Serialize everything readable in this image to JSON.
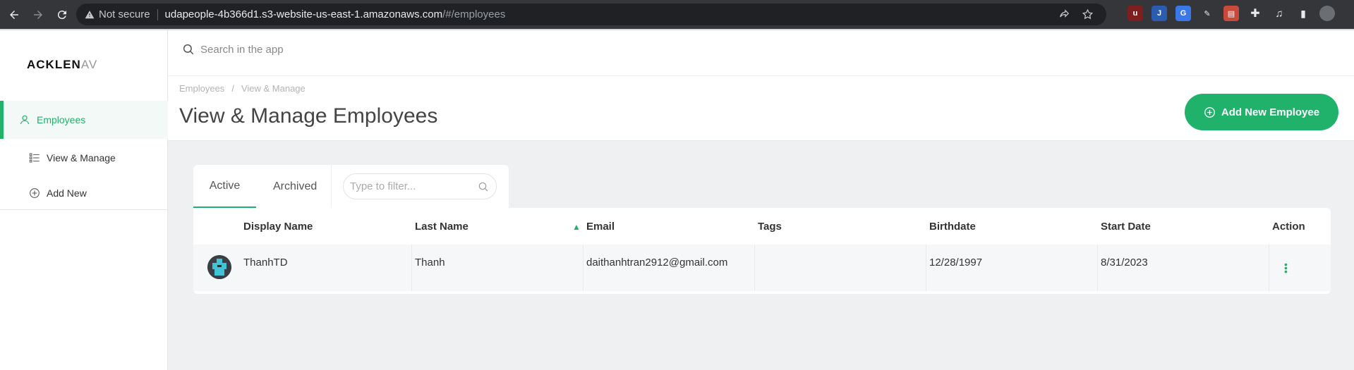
{
  "browser": {
    "security_label": "Not secure",
    "url_host": "udapeople-4b366d1.s3-website-us-east-1.amazonaws.com",
    "url_path": "/#/employees"
  },
  "sidebar": {
    "logo_main": "ACKLEN",
    "logo_tail": "AV",
    "items": [
      {
        "label": "Employees",
        "icon": "user-icon",
        "active": true
      },
      {
        "label": "View & Manage",
        "icon": "list-icon"
      },
      {
        "label": "Add New",
        "icon": "plus-circle-icon"
      }
    ]
  },
  "topbar": {
    "search_placeholder": "Search in the app"
  },
  "header": {
    "breadcrumb": [
      "Employees",
      "View & Manage"
    ],
    "title": "View & Manage Employees",
    "add_button_label": "Add New Employee"
  },
  "tabs": {
    "items": [
      "Active",
      "Archived"
    ],
    "active": "Active",
    "filter_placeholder": "Type to filter..."
  },
  "table": {
    "columns": [
      "Display Name",
      "Last Name",
      "Email",
      "Tags",
      "Birthdate",
      "Start Date",
      "Action"
    ],
    "sorted_column": "Email",
    "rows": [
      {
        "display_name": "ThanhTD",
        "last_name": "Thanh",
        "email": "daithanhtran2912@gmail.com",
        "tags": "",
        "birthdate": "12/28/1997",
        "start_date": "8/31/2023"
      }
    ]
  },
  "colors": {
    "accent": "#20b26b",
    "chrome_bg": "#35363a"
  }
}
